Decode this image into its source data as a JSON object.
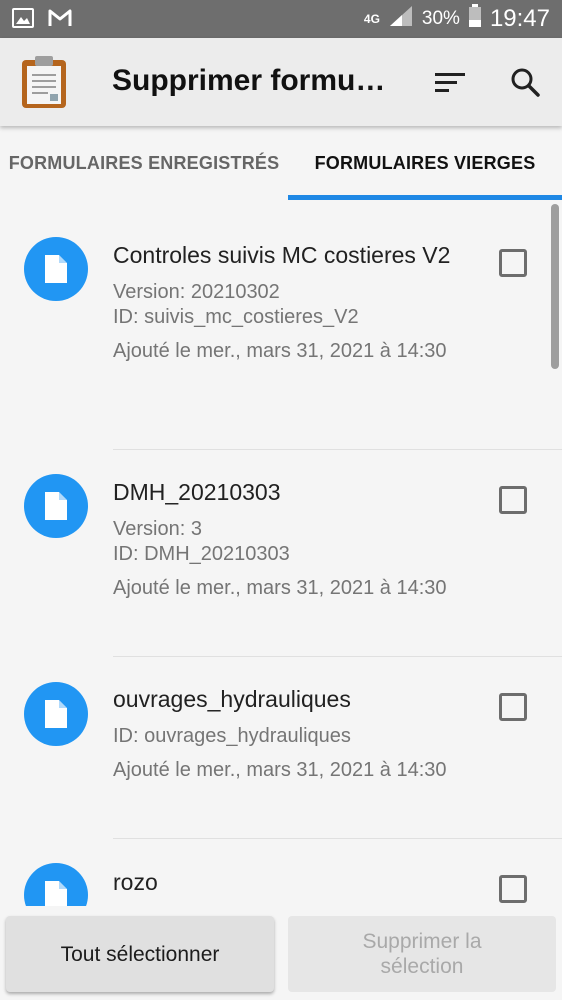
{
  "status_bar": {
    "network": "4G",
    "battery": "30%",
    "time": "19:47"
  },
  "app_bar": {
    "title": "Supprimer formulaires",
    "sort_icon": "sort-icon",
    "search_icon": "search-icon",
    "logo_icon": "clipboard-icon"
  },
  "tabs": [
    {
      "label": "FORMULAIRES ENREGISTRÉS",
      "active": false
    },
    {
      "label": "FORMULAIRES VIERGES",
      "active": true
    }
  ],
  "forms": [
    {
      "title": "Controles suivis MC costieres V2",
      "version": "Version: 20210302",
      "id": "ID: suivis_mc_costieres_V2",
      "added": "Ajouté le mer., mars 31, 2021 à 14:30",
      "checked": false
    },
    {
      "title": "DMH_20210303",
      "version": "Version: 3",
      "id": "ID: DMH_20210303",
      "added": "Ajouté le mer., mars 31, 2021 à 14:30",
      "checked": false
    },
    {
      "title": "ouvrages_hydrauliques",
      "id": "ID: ouvrages_hydrauliques",
      "added": "Ajouté le mer., mars 31, 2021 à 14:30",
      "checked": false
    },
    {
      "title": "rozo",
      "checked": false
    }
  ],
  "buttons": {
    "select_all": "Tout sélectionner",
    "delete_selection": "Supprimer la sélection"
  },
  "colors": {
    "accent": "#1e88e5",
    "avatar": "#2196f3",
    "status_bar": "#6e6e6e",
    "app_bar": "#ececec"
  }
}
